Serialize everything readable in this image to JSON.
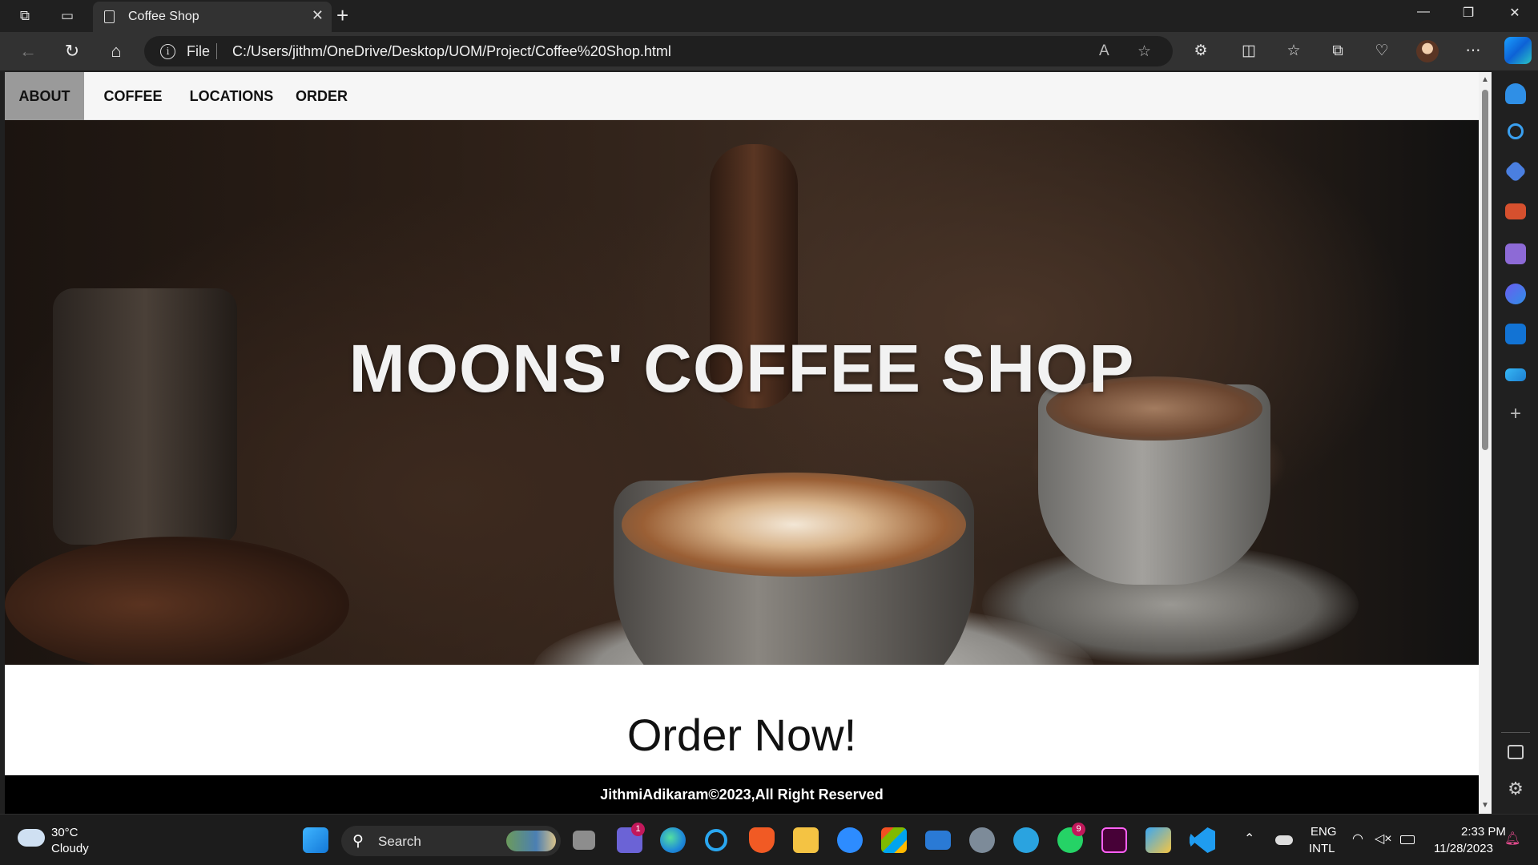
{
  "browser": {
    "tab_title": "Coffee Shop",
    "address_scheme_label": "File",
    "url": "C:/Users/jithm/OneDrive/Desktop/UOM/Project/Coffee%20Shop.html"
  },
  "site": {
    "nav": [
      "ABOUT",
      "COFFEE",
      "LOCATIONS",
      "ORDER"
    ],
    "active_nav": "ABOUT",
    "hero_title": "MOONS' COFFEE SHOP",
    "order_heading": "Order Now!",
    "footer_text": "JithmiAdikaram©2023,All Right Reserved"
  },
  "taskbar": {
    "weather_temp": "30°C",
    "weather_condition": "Cloudy",
    "search_label": "Search",
    "teams_badge": "1",
    "whatsapp_badge": "9",
    "language_line1": "ENG",
    "language_line2": "INTL",
    "time": "2:33 PM",
    "date": "11/28/2023"
  },
  "icons": {
    "taskbar_apps": [
      "windows-start",
      "task-view",
      "teams-chat",
      "edge",
      "cortana",
      "brave",
      "file-explorer",
      "zoom",
      "microsoft-store",
      "mail",
      "settings",
      "telegram",
      "whatsapp",
      "adobe-xd",
      "paint",
      "vscode"
    ],
    "sidebar": [
      "notifications",
      "search",
      "shopping-tag",
      "toolbox",
      "games",
      "copilot-bing",
      "outlook",
      "send",
      "add"
    ]
  },
  "colors": {
    "nav_active_bg": "#9a9a9a",
    "footer_bg": "#000000",
    "browser_chrome": "#202020"
  }
}
